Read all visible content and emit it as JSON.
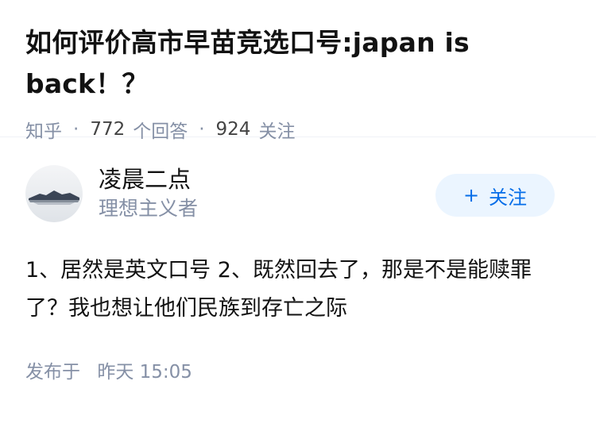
{
  "question": {
    "title": "如何评价高市早苗竞选口号:japan is back！？"
  },
  "meta": {
    "source": "知乎",
    "separator": "·",
    "answers_count": "772",
    "answers_label": "个回答",
    "followers_count": "924",
    "followers_label": "关注"
  },
  "author": {
    "name": "凌晨二点",
    "bio": "理想主义者"
  },
  "follow_button": {
    "icon": "+",
    "label": "关注"
  },
  "answer": {
    "text": "1、居然是英文口号 2、既然回去了，那是不是能赎罪了？我也想让他们民族到存亡之际"
  },
  "footer": {
    "published_label": "发布于",
    "published_time": "昨天 15:05"
  },
  "colors": {
    "accent": "#056de8",
    "follow_bg": "#ebf5ff",
    "muted": "#8590a6"
  }
}
